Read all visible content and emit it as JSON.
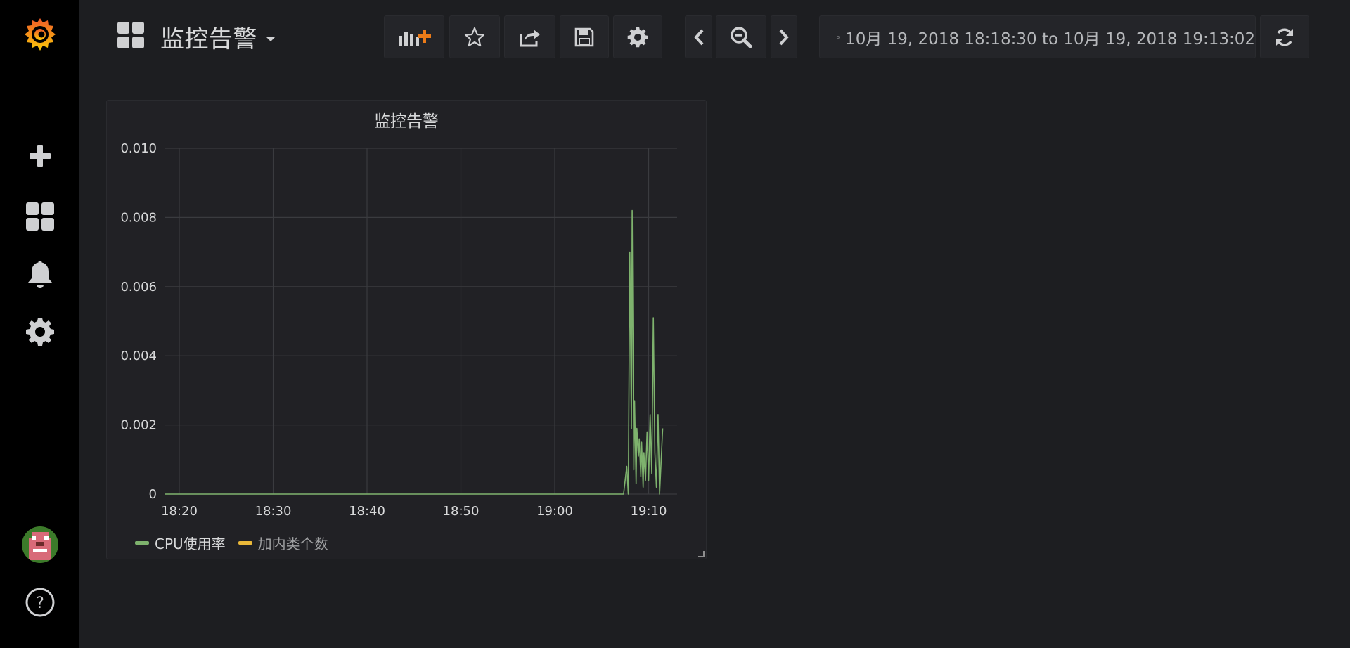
{
  "sidebar": {
    "items": [
      {
        "name": "grafana-logo-icon",
        "label": "Grafana"
      },
      {
        "name": "create-icon",
        "label": "Create"
      },
      {
        "name": "dashboards-icon",
        "label": "Dashboards"
      },
      {
        "name": "alerting-icon",
        "label": "Alerting"
      },
      {
        "name": "configuration-icon",
        "label": "Configuration"
      },
      {
        "name": "user-avatar",
        "label": "Profile"
      },
      {
        "name": "help-icon",
        "label": "Help"
      }
    ]
  },
  "header": {
    "dashboard_title": "监控告警",
    "buttons": [
      {
        "name": "add-panel-button",
        "icon": "add-panel-icon"
      },
      {
        "name": "star-button",
        "icon": "star-icon"
      },
      {
        "name": "share-button",
        "icon": "share-icon"
      },
      {
        "name": "save-button",
        "icon": "save-icon"
      },
      {
        "name": "settings-button",
        "icon": "gear-icon"
      },
      {
        "name": "time-back-button",
        "icon": "chevron-left-icon"
      },
      {
        "name": "zoom-out-button",
        "icon": "zoom-out-icon"
      },
      {
        "name": "time-forward-button",
        "icon": "chevron-right-icon"
      },
      {
        "name": "refresh-button",
        "icon": "refresh-icon"
      }
    ],
    "time_range": "10月 19, 2018 18:18:30 to 10月 19, 2018 19:13:02"
  },
  "colors": {
    "series_green": "#7eb26d",
    "series_yellow": "#eab839",
    "grafana_orange": "#f05a28",
    "background": "#1d1e21",
    "panel_bg": "#212125"
  },
  "panel": {
    "title": "监控告警",
    "legend": [
      {
        "label": "CPU使用率",
        "color": "#7eb26d"
      },
      {
        "label": "加内类个数",
        "color": "#eab839"
      }
    ]
  },
  "chart_data": {
    "type": "line",
    "title": "监控告警",
    "xlabel": "",
    "ylabel": "",
    "x_ticks": [
      "18:20",
      "18:30",
      "18:40",
      "18:50",
      "19:00",
      "19:10"
    ],
    "y_ticks": [
      "0",
      "0.002",
      "0.004",
      "0.006",
      "0.008",
      "0.010"
    ],
    "xlim": [
      "18:18:30",
      "19:13:02"
    ],
    "ylim": [
      0,
      0.01
    ],
    "grid": true,
    "legend_position": "bottom-left",
    "series": [
      {
        "name": "CPU使用率",
        "color": "#7eb26d",
        "points": [
          [
            "18:18:30",
            0
          ],
          [
            "19:07:20",
            0
          ],
          [
            "19:07:40",
            0.0008
          ],
          [
            "19:07:50",
            0
          ],
          [
            "19:08:00",
            0.007
          ],
          [
            "19:08:10",
            0.0019
          ],
          [
            "19:08:15",
            0.0082
          ],
          [
            "19:08:25",
            0.0007
          ],
          [
            "19:08:30",
            0.0027
          ],
          [
            "19:08:40",
            0.0003
          ],
          [
            "19:08:45",
            0.0019
          ],
          [
            "19:08:55",
            0.0011
          ],
          [
            "19:09:00",
            0.0016
          ],
          [
            "19:09:10",
            0.0005
          ],
          [
            "19:09:15",
            0.0015
          ],
          [
            "19:09:25",
            0.0002
          ],
          [
            "19:09:30",
            0.0012
          ],
          [
            "19:09:40",
            0.0004
          ],
          [
            "19:09:50",
            0.0018
          ],
          [
            "19:10:00",
            0.0004
          ],
          [
            "19:10:10",
            0.0023
          ],
          [
            "19:10:20",
            0.0006
          ],
          [
            "19:10:30",
            0.0051
          ],
          [
            "19:10:40",
            0.0012
          ],
          [
            "19:10:50",
            0.0002
          ],
          [
            "19:11:00",
            0.0023
          ],
          [
            "19:11:10",
            0
          ],
          [
            "19:11:30",
            0.0019
          ]
        ]
      },
      {
        "name": "加内类个数",
        "color": "#eab839",
        "points": []
      }
    ]
  }
}
